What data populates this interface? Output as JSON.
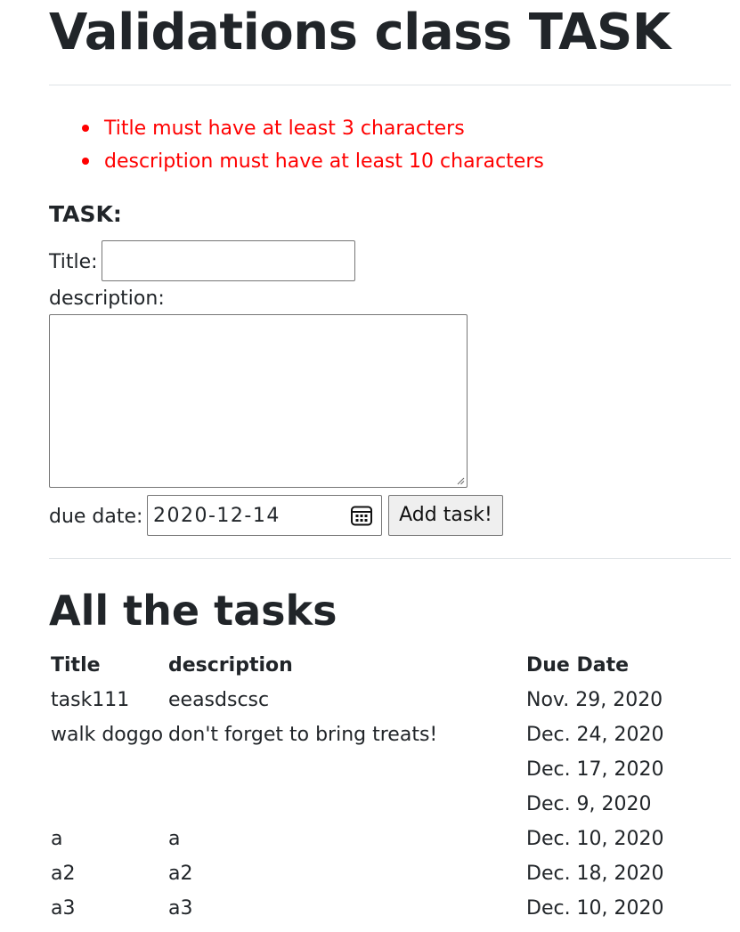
{
  "page_title": "Validations class TASK",
  "errors": [
    "Title must have at least 3 characters",
    "description must have at least 10 characters"
  ],
  "form": {
    "heading": "TASK:",
    "title_label": "Title:",
    "title_value": "",
    "description_label": "description:",
    "description_value": "",
    "due_label": "due date:",
    "due_value": "2020-12-14",
    "submit_label": "Add task!"
  },
  "tasks": {
    "heading": "All the tasks",
    "columns": [
      "Title",
      "description",
      "Due Date"
    ],
    "rows": [
      {
        "title": "task111",
        "description": "eeasdscsc",
        "due": "Nov. 29, 2020"
      },
      {
        "title": "walk doggo",
        "description": "don't forget to bring treats!",
        "due": "Dec. 24, 2020"
      },
      {
        "title": "",
        "description": "",
        "due": "Dec. 17, 2020"
      },
      {
        "title": "",
        "description": "",
        "due": "Dec. 9, 2020"
      },
      {
        "title": "a",
        "description": "a",
        "due": "Dec. 10, 2020"
      },
      {
        "title": "a2",
        "description": "a2",
        "due": "Dec. 18, 2020"
      },
      {
        "title": "a3",
        "description": "a3",
        "due": "Dec. 10, 2020"
      }
    ]
  },
  "colors": {
    "text": "#212529",
    "error": "#ff0000",
    "divider": "#dee2e6",
    "input_border": "#767676",
    "button_bg": "#efefef"
  }
}
